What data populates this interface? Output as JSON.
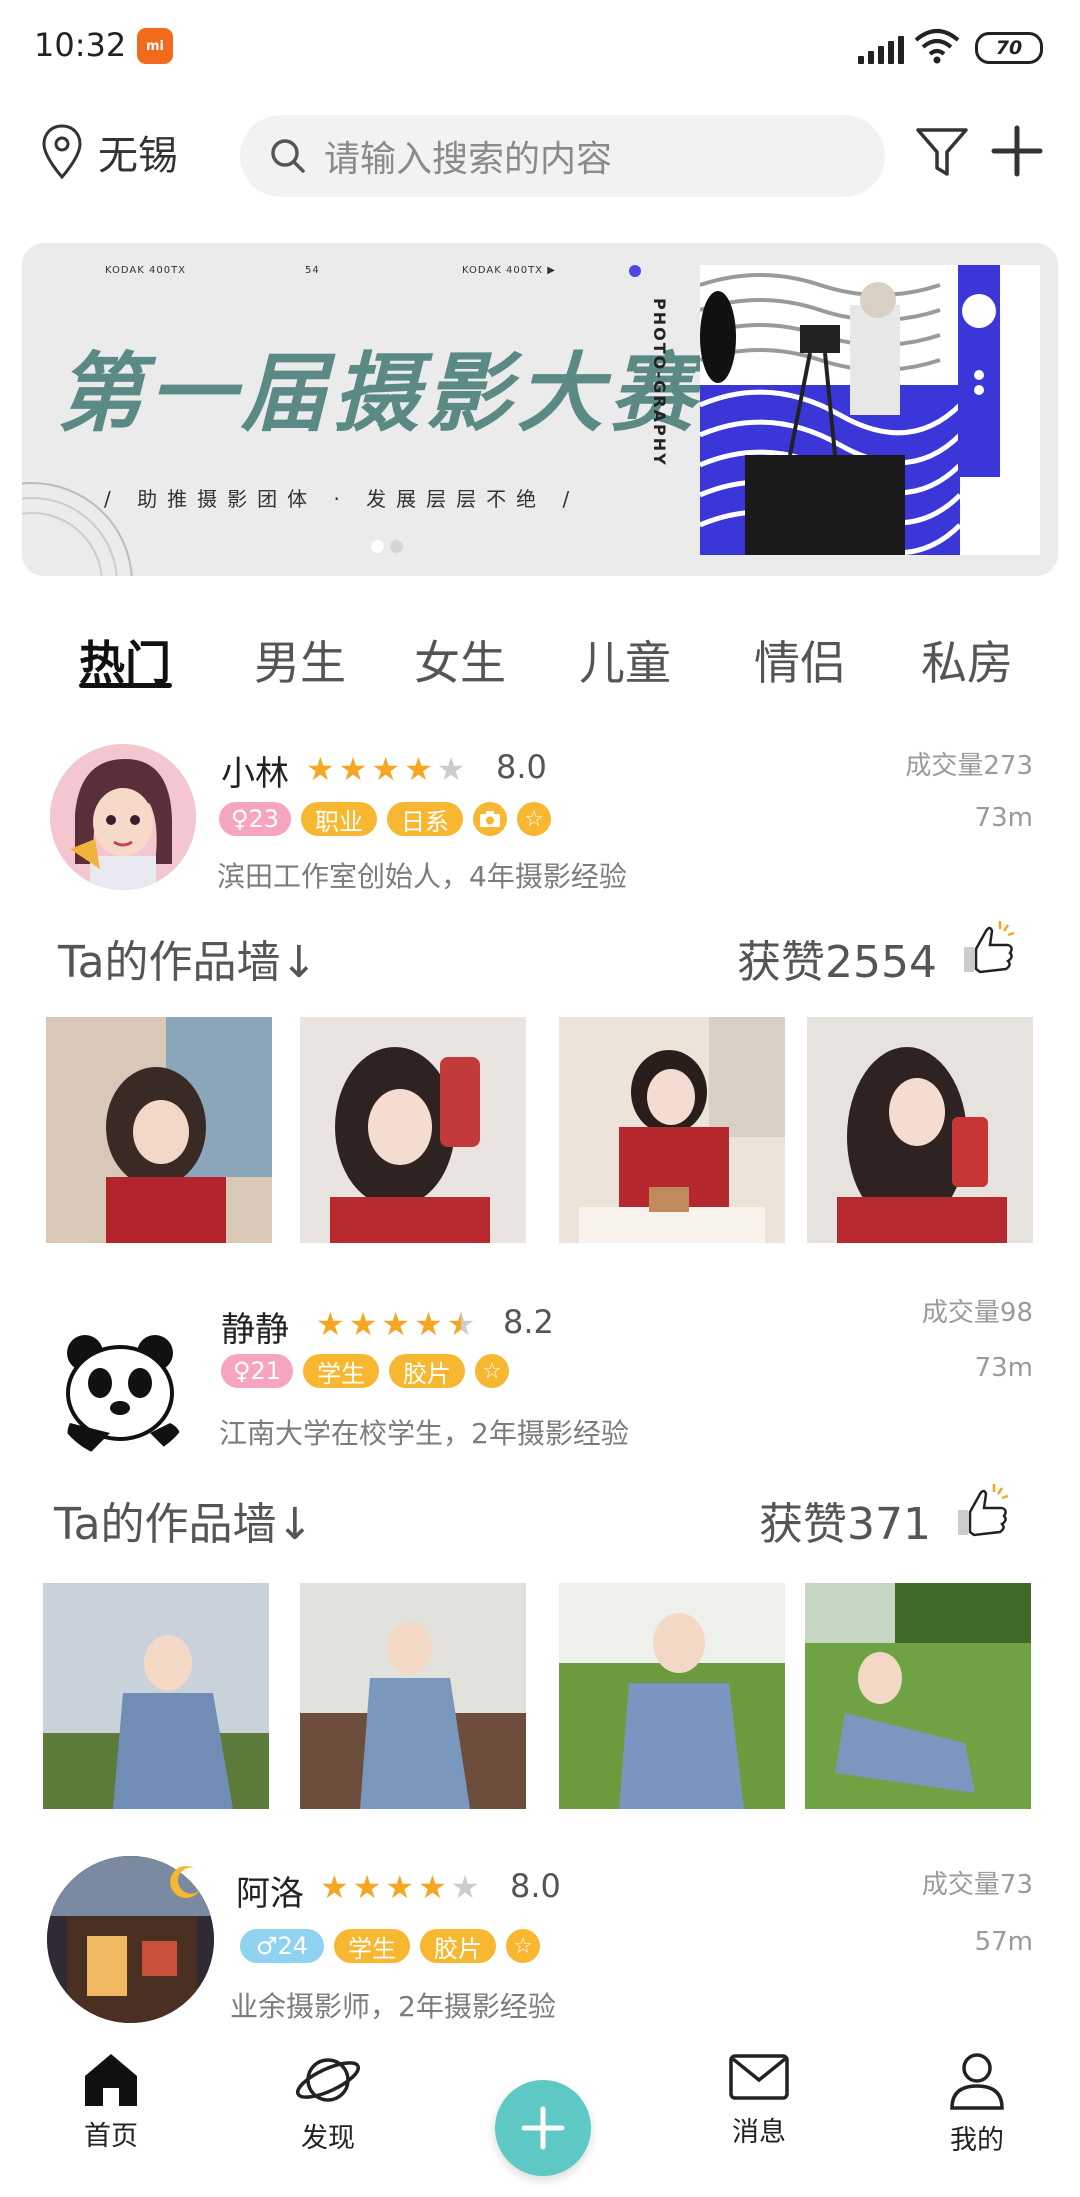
{
  "status_bar": {
    "time": "10:32",
    "app_badge": "mi",
    "battery": "70"
  },
  "header": {
    "location": "无锡",
    "search_placeholder": "请输入搜索的内容"
  },
  "banner": {
    "meta_left": "KODAK 400TX",
    "meta_mid": "54",
    "meta_right": "KODAK 400TX ▶",
    "title": "第一届摄影大赛",
    "subtitle": "/ 助推摄影团体 · 发展层层不绝 /",
    "vertical_text": "PHOTO-GRAPHY",
    "page_count": 2,
    "active_page": 1
  },
  "tabs": [
    {
      "label": "热门",
      "active": true
    },
    {
      "label": "男生",
      "active": false
    },
    {
      "label": "女生",
      "active": false
    },
    {
      "label": "儿童",
      "active": false
    },
    {
      "label": "情侣",
      "active": false
    },
    {
      "label": "私房",
      "active": false
    }
  ],
  "photographers": [
    {
      "name": "小林",
      "rating": "8.0",
      "stars": 4,
      "tags": [
        "♀23",
        "职业",
        "日系"
      ],
      "deals": "成交量273",
      "distance": "73m",
      "description": "滨田工作室创始人，4年摄影经验",
      "wall_title": "Ta的作品墙↓",
      "likes": "获赞2554"
    },
    {
      "name": "静静",
      "rating": "8.2",
      "stars": 4.5,
      "tags": [
        "♀21",
        "学生",
        "胶片"
      ],
      "deals": "成交量98",
      "distance": "73m",
      "description": "江南大学在校学生，2年摄影经验",
      "wall_title": "Ta的作品墙↓",
      "likes": "获赞371"
    },
    {
      "name": "阿洛",
      "rating": "8.0",
      "stars": 4,
      "tags": [
        "♂24",
        "学生",
        "胶片"
      ],
      "deals": "成交量73",
      "distance": "57m",
      "description": "业余摄影师，2年摄影经验"
    }
  ],
  "bottom_nav": [
    {
      "label": "首页",
      "icon": "home-icon"
    },
    {
      "label": "发现",
      "icon": "planet-icon"
    },
    {
      "label": "",
      "icon": "plus-icon"
    },
    {
      "label": "消息",
      "icon": "mail-icon"
    },
    {
      "label": "我的",
      "icon": "user-icon"
    }
  ],
  "colors": {
    "accent_teal": "#5ec8c4",
    "tag_orange": "#f7b731",
    "tag_pink": "#f6a5c0",
    "tag_blue": "#8fd3f0",
    "banner_title": "#5b8a85"
  }
}
